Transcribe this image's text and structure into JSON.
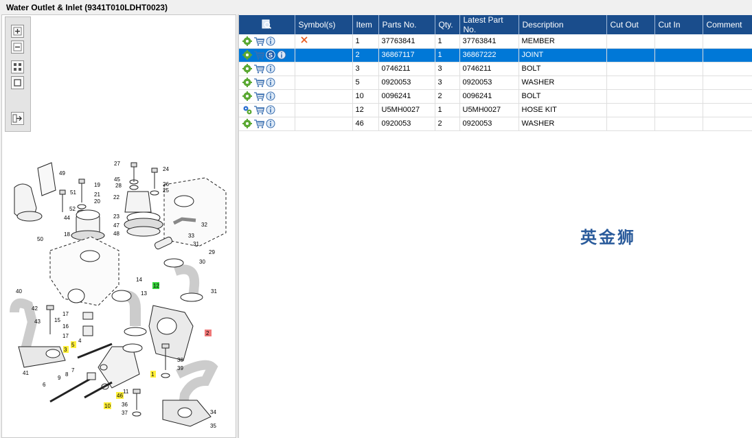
{
  "window": {
    "title": "Water Outlet & Inlet (9341T010LDHT0023)"
  },
  "toolbar": {
    "zoom_in": "zoom-in",
    "zoom_out": "zoom-out",
    "fit": "fit-page",
    "actual_size": "actual-size",
    "export": "export"
  },
  "table": {
    "headers": [
      "",
      "Symbol(s)",
      "Item",
      "Parts No.",
      "Qty.",
      "Latest Part No.",
      "Description",
      "Cut Out",
      "Cut In",
      "Comment"
    ],
    "rows": [
      {
        "icons": [
          "gear-icon",
          "cart-icon",
          "info-icon"
        ],
        "symbol": "x",
        "item": "1",
        "part_no": "37763841",
        "qty": "1",
        "latest": "37763841",
        "desc": "MEMBER",
        "cut_out": "",
        "cut_in": "",
        "comment": ""
      },
      {
        "icons": [
          "gear-icon",
          "cart-icon",
          "s-icon",
          "info-icon"
        ],
        "symbol": "",
        "item": "2",
        "part_no": "36867117",
        "qty": "1",
        "latest": "36867222",
        "desc": "JOINT",
        "cut_out": "",
        "cut_in": "",
        "comment": "",
        "selected": true
      },
      {
        "icons": [
          "gear-icon",
          "cart-icon",
          "info-icon"
        ],
        "symbol": "",
        "item": "3",
        "part_no": "0746211",
        "qty": "3",
        "latest": "0746211",
        "desc": "BOLT",
        "cut_out": "",
        "cut_in": "",
        "comment": ""
      },
      {
        "icons": [
          "gear-icon",
          "cart-icon",
          "info-icon"
        ],
        "symbol": "",
        "item": "5",
        "part_no": "0920053",
        "qty": "3",
        "latest": "0920053",
        "desc": "WASHER",
        "cut_out": "",
        "cut_in": "",
        "comment": ""
      },
      {
        "icons": [
          "gear-icon",
          "cart-icon",
          "info-icon"
        ],
        "symbol": "",
        "item": "10",
        "part_no": "0096241",
        "qty": "2",
        "latest": "0096241",
        "desc": "BOLT",
        "cut_out": "",
        "cut_in": "",
        "comment": ""
      },
      {
        "icons": [
          "gears-icon",
          "cart-icon",
          "info-icon"
        ],
        "symbol": "",
        "item": "12",
        "part_no": "U5MH0027",
        "qty": "1",
        "latest": "U5MH0027",
        "desc": "HOSE KIT",
        "cut_out": "",
        "cut_in": "",
        "comment": ""
      },
      {
        "icons": [
          "gear-icon",
          "cart-icon",
          "info-icon"
        ],
        "symbol": "",
        "item": "46",
        "part_no": "0920053",
        "qty": "2",
        "latest": "0920053",
        "desc": "WASHER",
        "cut_out": "",
        "cut_in": "",
        "comment": ""
      }
    ]
  },
  "watermark": "英金狮",
  "diagram": {
    "callouts": [
      "27",
      "24",
      "49",
      "45",
      "28",
      "26",
      "25",
      "19",
      "51",
      "21",
      "20",
      "22",
      "52",
      "44",
      "23",
      "47",
      "48",
      "32",
      "18",
      "50",
      "33",
      "31",
      "30",
      "29",
      "14",
      "12",
      "13",
      "40",
      "42",
      "43",
      "15",
      "17",
      "16",
      "17",
      "2",
      "5",
      "4",
      "3",
      "41",
      "38",
      "39",
      "1",
      "7",
      "8",
      "9",
      "6",
      "46",
      "10",
      "11",
      "36",
      "37",
      "34",
      "35",
      "31"
    ],
    "highlight_yellow": [
      "5",
      "3",
      "1",
      "46",
      "10"
    ],
    "highlight_green": [
      "12"
    ],
    "highlight_red": [
      "2"
    ]
  },
  "colors": {
    "header_bg": "#1a4d8c",
    "selected_row": "#0078d7",
    "watermark": "#2a5b9b"
  }
}
